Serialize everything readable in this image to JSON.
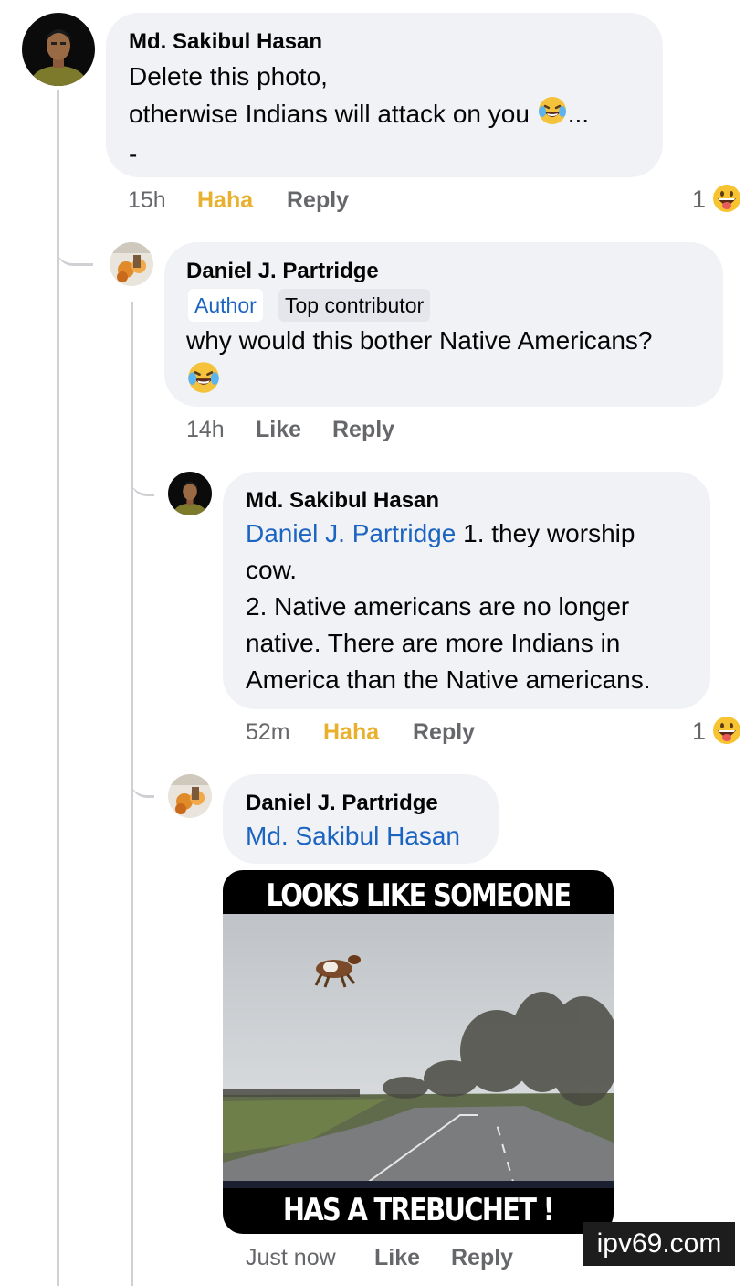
{
  "comments": [
    {
      "author": "Md. Sakibul Hasan",
      "lines": [
        "Delete this photo,",
        "otherwise Indians will attack on you",
        "...",
        "-"
      ],
      "time": "15h",
      "reaction_label": "Haha",
      "reply_label": "Reply",
      "reaction_count": "1"
    },
    {
      "author": "Daniel J. Partridge",
      "badges": [
        "Author",
        "Top contributor"
      ],
      "lines": [
        "why would this bother Native Americans?"
      ],
      "time": "14h",
      "like_label": "Like",
      "reply_label": "Reply"
    },
    {
      "author": "Md. Sakibul Hasan",
      "mention": "Daniel J. Partridge",
      "lines": [
        " 1. they worship",
        "cow.",
        "2. Native americans are no longer",
        "native. There are more Indians in",
        "America than the Native americans."
      ],
      "time": "52m",
      "reaction_label": "Haha",
      "reply_label": "Reply",
      "reaction_count": "1"
    },
    {
      "author": "Daniel J. Partridge",
      "mention": "Md. Sakibul Hasan",
      "meme_top": "LOOKS LIKE SOMEONE",
      "meme_bottom": "HAS A TREBUCHET !",
      "time": "Just now",
      "like_label": "Like",
      "reply_label": "Reply"
    }
  ],
  "watermark": "ipv69.com",
  "colors": {
    "bubble": "#f0f2f5",
    "link": "#1c64c2",
    "haha": "#e8b02c",
    "meta": "#65676b",
    "thread": "#ced0d4"
  },
  "icons": [
    "laughing-tears-emoji",
    "grinning-tongue-emoji"
  ]
}
